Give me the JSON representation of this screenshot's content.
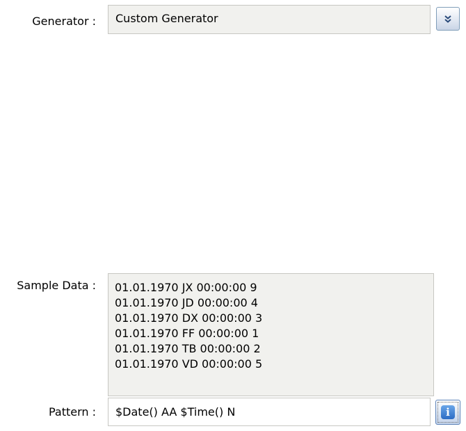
{
  "generator": {
    "label": "Generator :",
    "value": "Custom Generator",
    "dropdown_icon": "double-chevron-down-icon"
  },
  "sample_data": {
    "label": "Sample Data :",
    "lines": [
      "01.01.1970 JX 00:00:00 9",
      "01.01.1970 JD 00:00:00 4",
      "01.01.1970 DX 00:00:00 3",
      "01.01.1970 FF 00:00:00 1",
      "01.01.1970 TB 00:00:00 2",
      "01.01.1970 VD 00:00:00 5"
    ]
  },
  "pattern": {
    "label": "Pattern :",
    "value": "$Date() AA $Time() N",
    "info_icon": "info-icon",
    "info_glyph": "i"
  },
  "colors": {
    "field_background": "#f1f1ee",
    "field_border": "#c7c7c2",
    "button_border": "#7f9db9",
    "info_icon_blue": "#2c6cc4"
  }
}
